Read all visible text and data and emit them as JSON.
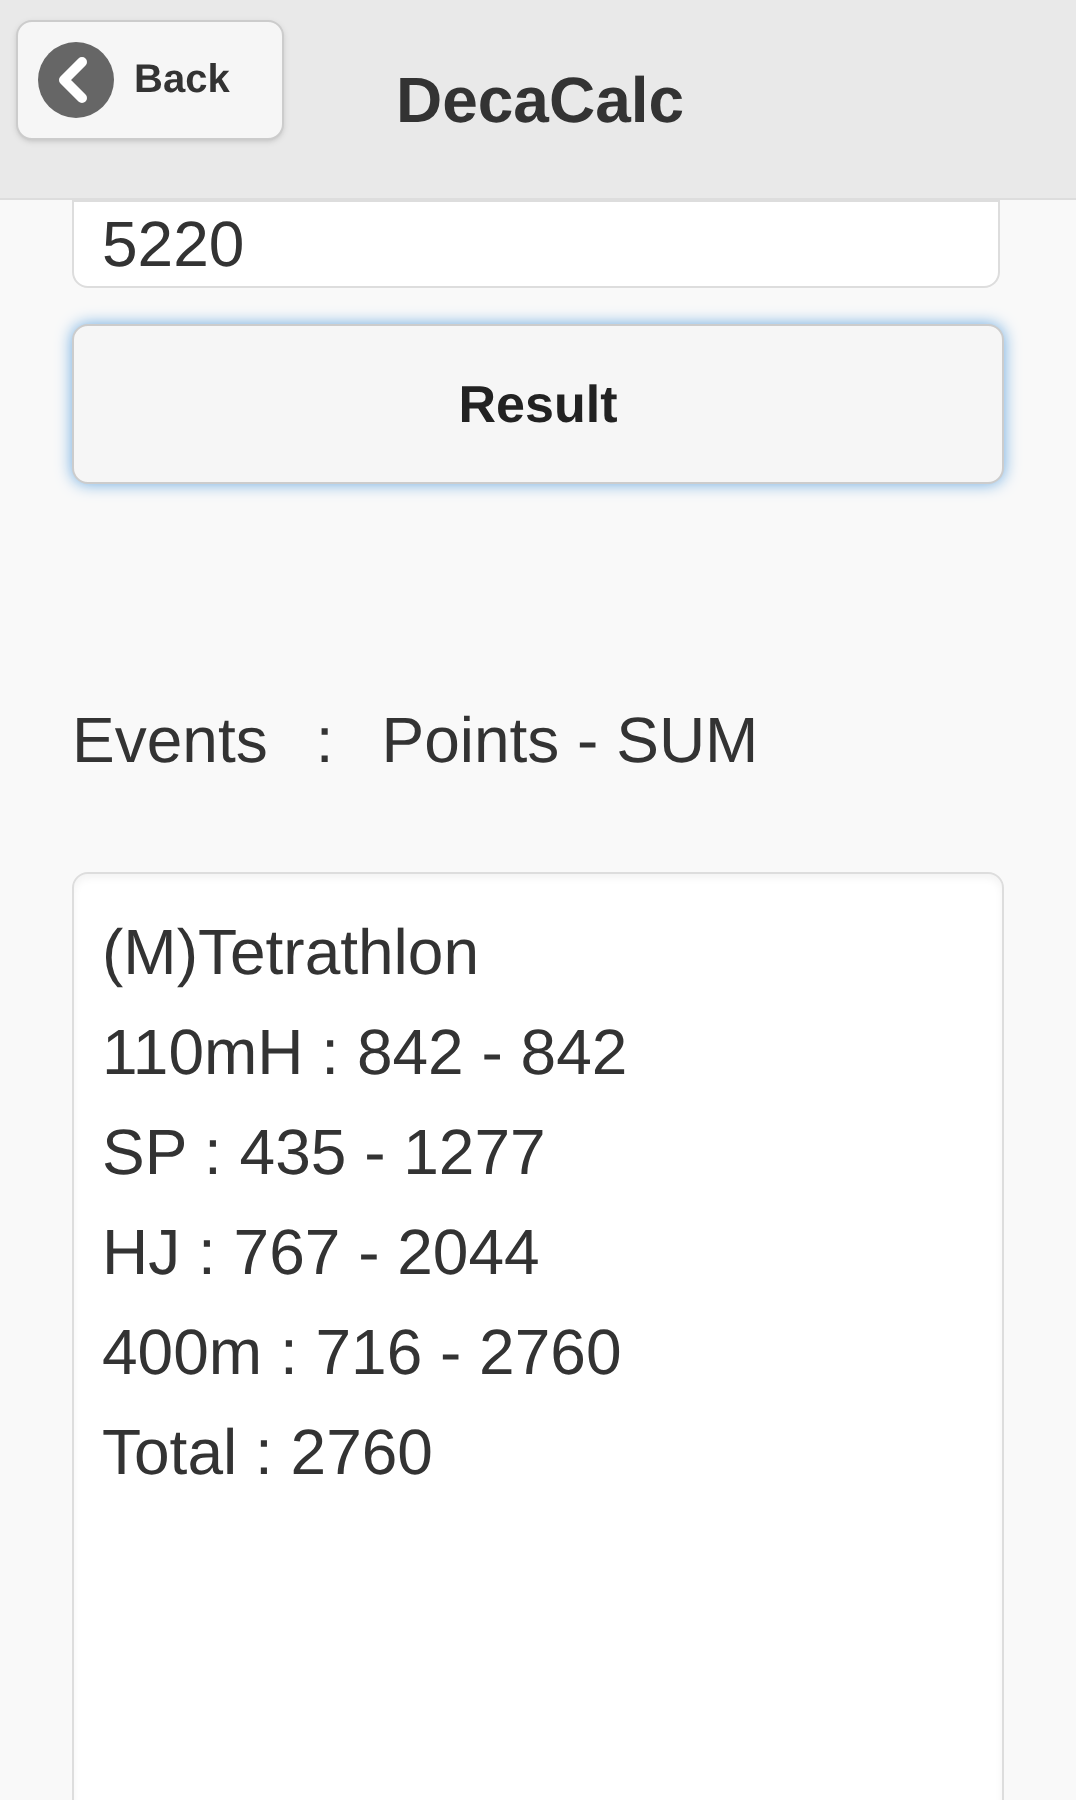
{
  "header": {
    "back_button": "Back",
    "title": "DecaCalc"
  },
  "score_field": {
    "value": "5220"
  },
  "result_button": "Result",
  "legend": {
    "events": "Events",
    "separator": ":",
    "points": "Points - SUM"
  },
  "output": {
    "lines": [
      "(M)Tetrathlon",
      "110mH : 842 - 842",
      "SP : 435 - 1277",
      "HJ : 767 - 2044",
      "400m : 716 - 2760",
      "Total : 2760"
    ]
  }
}
